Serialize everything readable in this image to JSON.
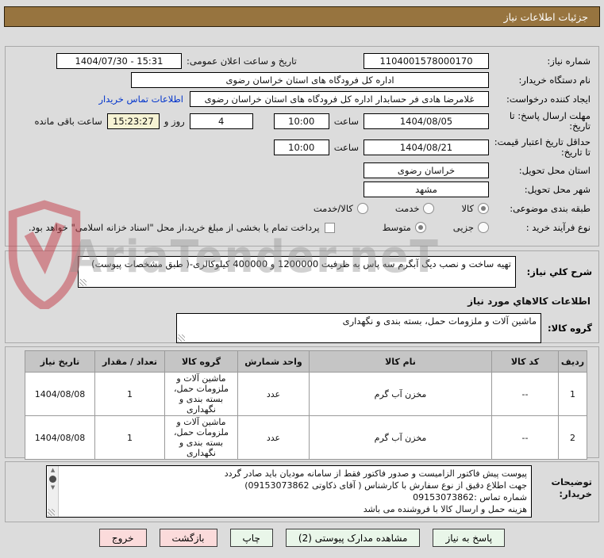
{
  "title_bar": {
    "text": "جزئیات اطلاعات نیاز"
  },
  "watermark": {
    "text": "AriaTender.neT",
    "shield_color": "#c43a46",
    "text_color": "#8f8f8f"
  },
  "icons": {
    "scroll_up": "▲",
    "scroll_down": "▼"
  },
  "colors": {
    "titlebar": "#97743F",
    "countdown_bg": "#F6F3D4",
    "button_green": "#E9F6E9",
    "button_pink": "#FBDBDB",
    "link_blue": "#0033CC",
    "table_header_bg": "#C5C5C5"
  },
  "form": {
    "need_number": {
      "label": "شماره نیاز:",
      "value": "1104001578000170"
    },
    "announce_datetime": {
      "label": "تاریخ و ساعت اعلان عمومی:",
      "value": "1404/07/30 - 15:31"
    },
    "buyer_org": {
      "label": "نام دستگاه خریدار:",
      "value": "اداره کل فرودگاه های استان خراسان رضوی"
    },
    "request_creator": {
      "label": "ایجاد کننده درخواست:",
      "value": "غلامرضا هادی فر حسابدار اداره کل فرودگاه های استان خراسان رضوی"
    },
    "buyer_contact_link": "اطلاعات تماس خریدار",
    "response_deadline": {
      "label": "مهلت ارسال پاسخ: تا تاریخ:",
      "date": "1404/08/05",
      "hour_label": "ساعت",
      "time": "10:00"
    },
    "remaining": {
      "days": "4",
      "days_label": "روز و",
      "countdown": "15:23:27",
      "suffix": "ساعت باقی مانده"
    },
    "price_validity": {
      "label": "حداقل تاریخ اعتبار قیمت: تا تاریخ:",
      "date": "1404/08/21",
      "hour_label": "ساعت",
      "time": "10:00"
    },
    "delivery_province": {
      "label": "استان محل تحویل:",
      "value": "خراسان رضوی"
    },
    "delivery_city": {
      "label": "شهر محل تحویل:",
      "value": "مشهد"
    },
    "subject_class": {
      "label": "طبقه بندی موضوعی:",
      "options": [
        "کالا",
        "خدمت",
        "کالا/خدمت"
      ],
      "selected": "کالا"
    },
    "process_type": {
      "label": "نوع فرآیند خرید :",
      "options": [
        "جزیی",
        "متوسط"
      ],
      "selected": "متوسط"
    },
    "treasury_checkbox": {
      "label": "پرداخت تمام یا بخشی از مبلغ خرید،از محل \"اسناد خزانه اسلامی\" خواهد بود.",
      "checked": false
    },
    "need_description": {
      "label": "شرح کلي نياز:",
      "value": "تهیه ساخت و نصب دیگ آبگرم سه پاس به ظرفیت 1200000 و 400000 کیلوکالری-( طبق مشخصات پیوست)"
    },
    "goods_section_title": "اطلاعات کالاهاي مورد نياز",
    "goods_group": {
      "label": "گروه کالا:",
      "value": "ماشین آلات و ملزومات حمل، بسته بندی و نگهداری"
    }
  },
  "table": {
    "headers": [
      "ردیف",
      "کد کالا",
      "نام کالا",
      "واحد شمارش",
      "گروه کالا",
      "تعداد / مقدار",
      "تاریخ نیاز"
    ],
    "rows": [
      [
        "1",
        "--",
        "مخزن آب گرم",
        "عدد",
        "ماشین آلات و ملزومات حمل، بسته بندی و نگهداری",
        "1",
        "1404/08/08"
      ],
      [
        "2",
        "--",
        "مخزن آب گرم",
        "عدد",
        "ماشین آلات و ملزومات حمل، بسته بندی و نگهداری",
        "1",
        "1404/08/08"
      ]
    ]
  },
  "buyer_notes": {
    "label": "توضیحات خریدار:",
    "lines": [
      "پیوست پیش فاکتور الزامیست و صدور فاکتور فقط از سامانه مودیان باید صادر گردد",
      "جهت اطلاع دقیق از نوع سفارش با کارشناس  ( آقای ذکاوتی 09153073862)",
      "شماره تماس :09153073862",
      "هزینه حمل و ارسال کالا با فروشنده می باشد"
    ]
  },
  "buttons": [
    {
      "label": "پاسخ به نیاز",
      "type": "green"
    },
    {
      "label": "مشاهده مدارک پیوستی (2)",
      "type": "green"
    },
    {
      "label": "چاپ",
      "type": "green"
    },
    {
      "label": "بازگشت",
      "type": "pink"
    },
    {
      "label": "خروج",
      "type": "pink"
    }
  ]
}
